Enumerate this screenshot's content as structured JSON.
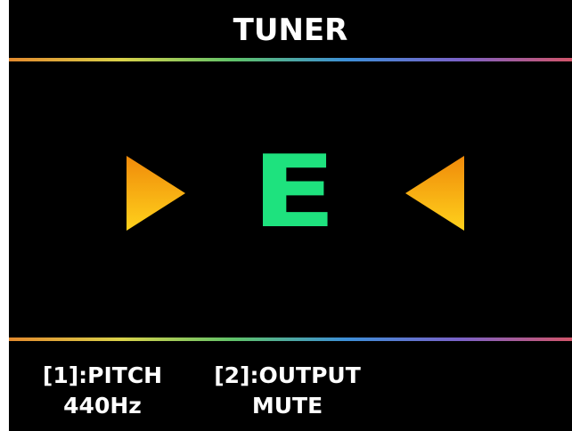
{
  "screen": {
    "title": "TUNER",
    "background": "#000000",
    "text_color": "#ffffff",
    "rule_gradient": [
      "#e38a2e",
      "#d9d24a",
      "#5fc26a",
      "#3d8fd8",
      "#7a62c8",
      "#d2556a"
    ]
  },
  "tuner": {
    "note": "E",
    "note_color": "#1ee27e",
    "indicator_left_icon": "triangle-right-icon",
    "indicator_right_icon": "triangle-left-icon",
    "indicator_colors": [
      "#ffd21c",
      "#f08a0a"
    ],
    "in_tune": true
  },
  "footer": {
    "params": [
      {
        "label": "[1]:PITCH",
        "value": "440Hz"
      },
      {
        "label": "[2]:OUTPUT",
        "value": "MUTE"
      }
    ]
  }
}
